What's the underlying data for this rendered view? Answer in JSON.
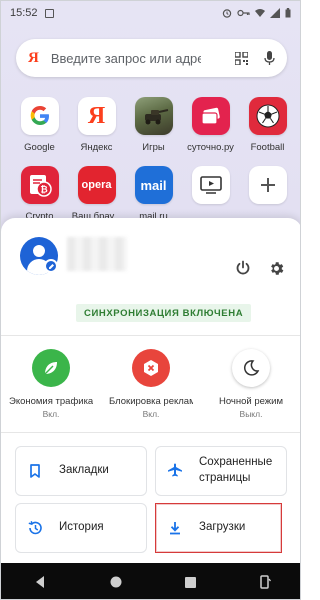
{
  "status": {
    "time": "15:52"
  },
  "search": {
    "logo": "Я",
    "placeholder": "Введите запрос или адрес"
  },
  "speed_dial": [
    {
      "label": "Google",
      "icon": "google-icon"
    },
    {
      "label": "Яндекс",
      "icon": "yandex-icon"
    },
    {
      "label": "Игры",
      "icon": "games-icon"
    },
    {
      "label": "суточно.ру",
      "icon": "sutochno-icon"
    },
    {
      "label": "Football",
      "icon": "football-icon"
    },
    {
      "label": "Crypto",
      "icon": "crypto-icon"
    },
    {
      "label": "Ваш брау...",
      "icon": "opera-icon",
      "logo_text": "opera"
    },
    {
      "label": "mail.ru",
      "icon": "mailru-icon",
      "logo_text": "mail"
    },
    {
      "label": "",
      "icon": "tv-screen-icon"
    },
    {
      "label": "",
      "icon": "add-icon"
    }
  ],
  "profile": {
    "sync_badge": "СИНХРОНИЗАЦИЯ ВКЛЮЧЕНА"
  },
  "features": [
    {
      "title": "Экономия трафика",
      "state": "Вкл.",
      "icon": "leaf-icon",
      "color": "#3bb54a"
    },
    {
      "title": "Блокировка рекламы",
      "state": "Вкл.",
      "icon": "ad-block-icon",
      "color": "#e8453c"
    },
    {
      "title": "Ночной режим",
      "state": "Выкл.",
      "icon": "moon-icon",
      "color": "#ffffff"
    }
  ],
  "menu": {
    "bookmarks": "Закладки",
    "saved_pages_line1": "Сохраненные",
    "saved_pages_line2": "страницы",
    "history": "История",
    "downloads": "Загрузки"
  },
  "colors": {
    "accent": "#1a73e8",
    "yandex_red": "#fc3f1d",
    "highlight": "#d63a3a"
  }
}
